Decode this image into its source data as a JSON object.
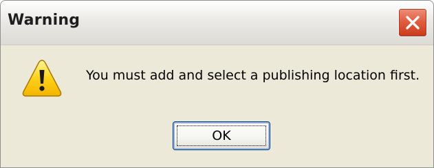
{
  "dialog": {
    "title": "Warning",
    "message": "You must add and select a publishing location first.",
    "ok_label": "OK",
    "close_icon": "close-icon",
    "warning_icon": "warning-icon"
  },
  "colors": {
    "dialog_background": "#ece9d8",
    "close_button_red": "#e15f41",
    "warning_yellow": "#ffd21a",
    "focus_border": "#003c74"
  }
}
